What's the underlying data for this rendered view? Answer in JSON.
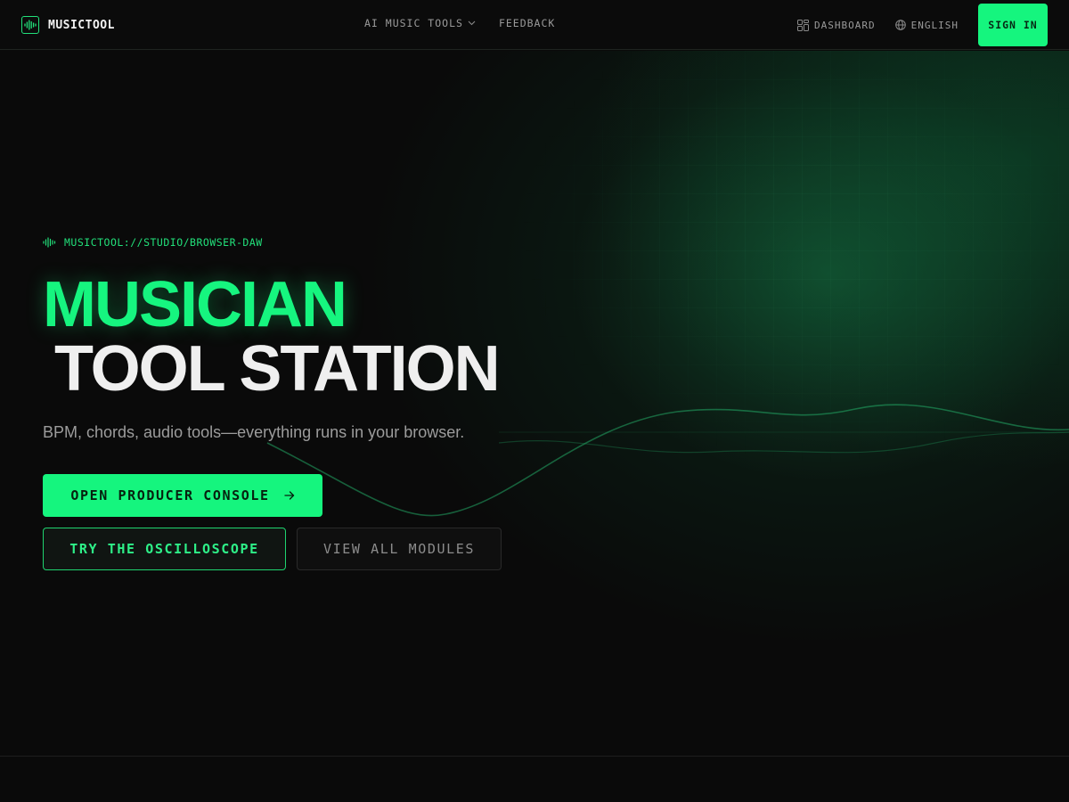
{
  "brand": {
    "name": "MUSICTOOL",
    "icon": "waveform-icon"
  },
  "nav": {
    "center": [
      {
        "label": "AI MUSIC TOOLS",
        "icon": "chevron-down-icon"
      },
      {
        "label": "FEEDBACK"
      }
    ],
    "dashboard": {
      "label": "DASHBOARD",
      "icon": "dashboard-grid-icon"
    },
    "language": {
      "label": "ENGLISH",
      "icon": "globe-icon"
    },
    "signin_label": "SIGN IN"
  },
  "hero": {
    "eyebrow": "MUSICTOOL://STUDIO/BROWSER-DAW",
    "headline_line1": "MUSICIAN",
    "headline_line2": "TOOL STATION",
    "subtitle": "BPM, chords, audio tools—everything runs in your browser.",
    "primary_cta": "OPEN PRODUCER CONSOLE",
    "primary_cta_icon": "arrow-right-icon",
    "secondary_cta": "TRY THE OSCILLOSCOPE",
    "tertiary_cta": "VIEW ALL MODULES"
  },
  "colors": {
    "accent": "#15f57e",
    "background": "#0a0a0a",
    "text_muted": "#9c9c9c"
  }
}
